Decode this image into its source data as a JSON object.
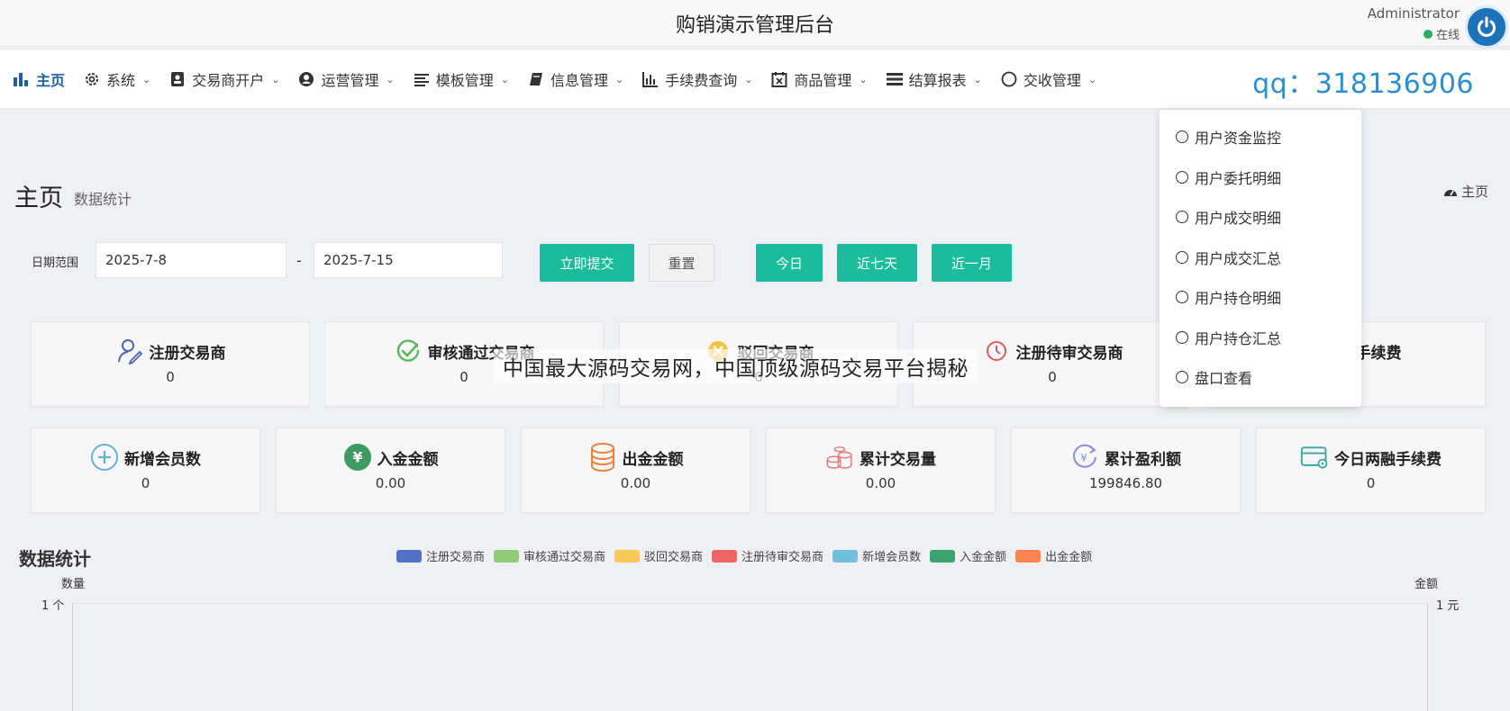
{
  "header": {
    "title": "购销演示管理后台",
    "user_name": "Administrator",
    "status": "在线"
  },
  "nav": {
    "items": [
      {
        "label": "主页",
        "icon": "bar-chart-icon",
        "caret": ""
      },
      {
        "label": "系统",
        "icon": "gear-icon",
        "caret": "⌄"
      },
      {
        "label": "交易商开户",
        "icon": "id-card-icon",
        "caret": "⌄"
      },
      {
        "label": "运营管理",
        "icon": "user-circle-icon",
        "caret": "⌄"
      },
      {
        "label": "模板管理",
        "icon": "list-icon",
        "caret": "⌄"
      },
      {
        "label": "信息管理",
        "icon": "book-icon",
        "caret": "⌄"
      },
      {
        "label": "手续费查询",
        "icon": "column-chart-icon",
        "caret": "⌄"
      },
      {
        "label": "商品管理",
        "icon": "calendar-x-icon",
        "caret": "⌄"
      },
      {
        "label": "结算报表",
        "icon": "stack-icon",
        "caret": "⌄"
      },
      {
        "label": "交收管理",
        "icon": "circle-icon",
        "caret": "⌄"
      }
    ],
    "qq": "qq：318136906"
  },
  "dropdown": {
    "items": [
      "用户资金监控",
      "用户委托明细",
      "用户成交明细",
      "用户成交汇总",
      "用户持仓明细",
      "用户持仓汇总",
      "盘口查看"
    ]
  },
  "page": {
    "title": "主页",
    "subtitle": "数据统计",
    "breadcrumb": "主页"
  },
  "filter": {
    "label": "日期范围",
    "start": "2025-7-8",
    "end": "2025-7-15",
    "sep": "-",
    "submit": "立即提交",
    "reset": "重置",
    "today": "今日",
    "week": "近七天",
    "month": "近一月"
  },
  "stats_row1": [
    {
      "title": "注册交易商",
      "value": "0",
      "icon": "user-edit-icon"
    },
    {
      "title": "审核通过交易商",
      "value": "0",
      "icon": "check-circle-icon"
    },
    {
      "title": "驳回交易商",
      "value": "0",
      "icon": "reject-icon"
    },
    {
      "title": "注册待审交易商",
      "value": "0",
      "icon": "pending-icon"
    },
    {
      "title": "撤销手续费",
      "value": "0",
      "icon": "fee-icon"
    }
  ],
  "stats_row2": [
    {
      "title": "新增会员数",
      "value": "0",
      "icon": "plus-circle-icon"
    },
    {
      "title": "入金金额",
      "value": "0.00",
      "icon": "yen-icon"
    },
    {
      "title": "出金金额",
      "value": "0.00",
      "icon": "coin-stack-icon"
    },
    {
      "title": "累计交易量",
      "value": "0.00",
      "icon": "coins-icon"
    },
    {
      "title": "累计盈利额",
      "value": "199846.80",
      "icon": "profit-icon"
    },
    {
      "title": "今日两融手续费",
      "value": "0",
      "icon": "card-icon"
    }
  ],
  "watermark": "中国最大源码交易网，中国顶级源码交易平台揭秘",
  "chart_data": {
    "type": "bar",
    "title": "数据统计",
    "series": [
      {
        "name": "注册交易商",
        "color": "#5470c6"
      },
      {
        "name": "审核通过交易商",
        "color": "#91cc75"
      },
      {
        "name": "驳回交易商",
        "color": "#fac858"
      },
      {
        "name": "注册待审交易商",
        "color": "#ee6666"
      },
      {
        "name": "新增会员数",
        "color": "#73c0de"
      },
      {
        "name": "入金金额",
        "color": "#3ba272"
      },
      {
        "name": "出金金额",
        "color": "#fc8452"
      }
    ],
    "ylabel_left": "数量",
    "ylabel_right": "金额",
    "ytick_left": "1 个",
    "ytick_right": "1 元",
    "legend_position": "top-center"
  }
}
